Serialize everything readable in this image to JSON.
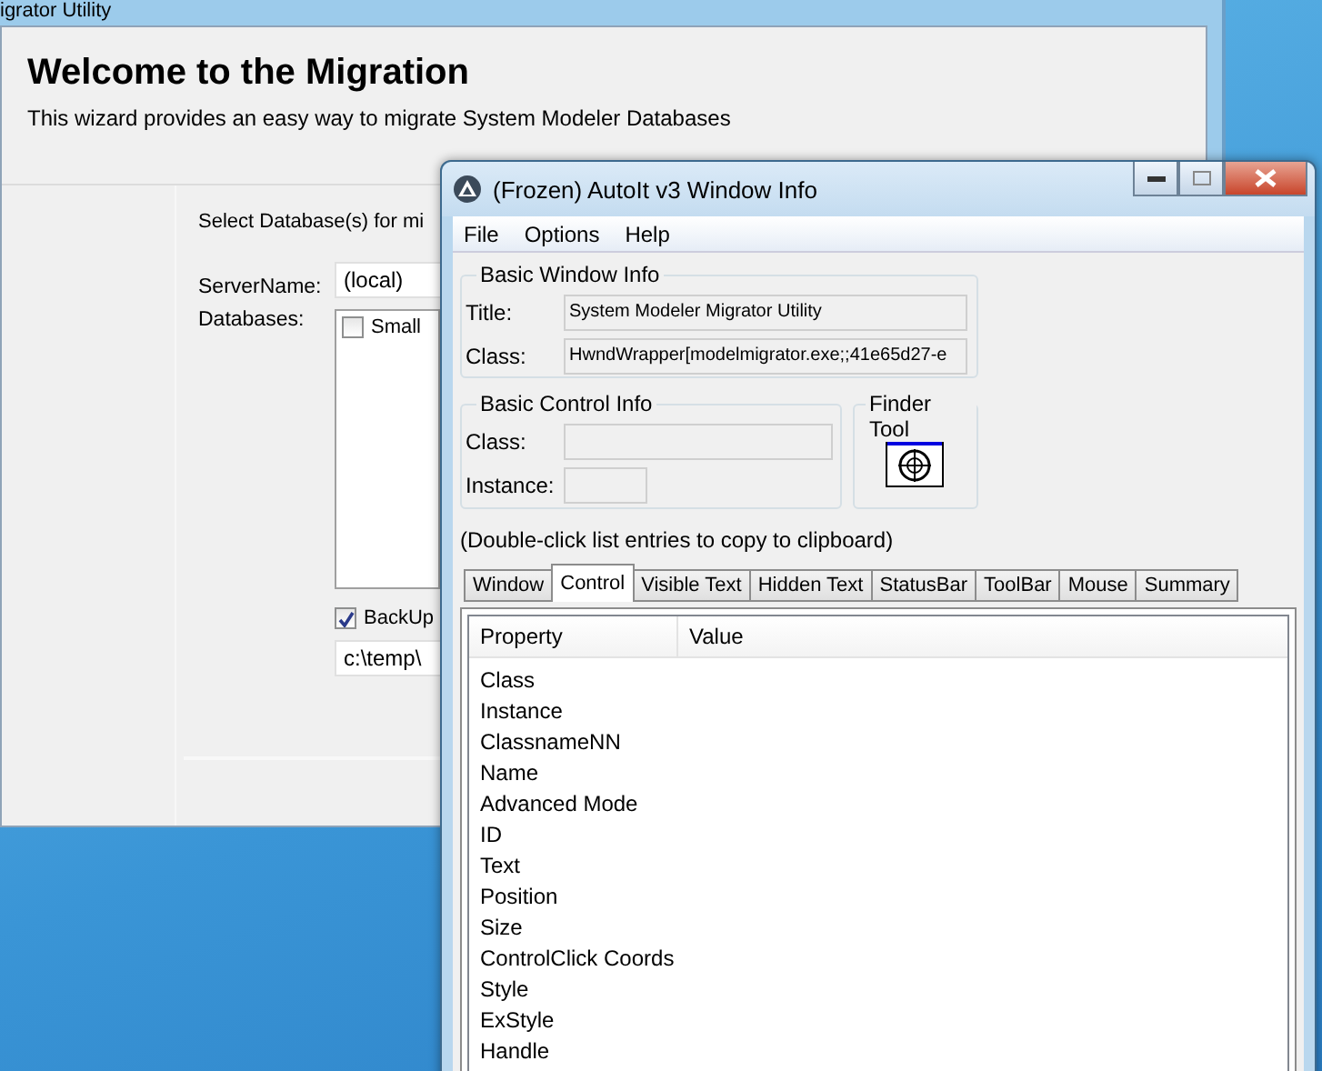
{
  "background_window": {
    "title": "igrator Utility",
    "heading": "Welcome to the Migration",
    "subtitle": "This wizard provides an easy way to migrate System Modeler Databases",
    "prompt": "Select Database(s) for mi",
    "server_label": "ServerName:",
    "server_value": "(local)",
    "databases_label": "Databases:",
    "databases": [
      {
        "label": "Small",
        "checked": false
      }
    ],
    "backup": {
      "label": "BackUp",
      "checked": true
    },
    "backup_path": "c:\\temp\\"
  },
  "autoit_window": {
    "title": "(Frozen) AutoIt v3 Window Info",
    "menu": [
      "File",
      "Options",
      "Help"
    ],
    "basic_window_info": {
      "legend": "Basic Window Info",
      "fields": [
        {
          "label": "Title:",
          "value": "System Modeler Migrator Utility"
        },
        {
          "label": "Class:",
          "value": "HwndWrapper[modelmigrator.exe;;41e65d27-e"
        }
      ]
    },
    "basic_control_info": {
      "legend": "Basic Control Info",
      "fields": [
        {
          "label": "Class:"
        },
        {
          "label": "Instance:"
        }
      ]
    },
    "finder_tool": {
      "legend": "Finder Tool"
    },
    "hint": "(Double-click list entries to copy to clipboard)",
    "tabs": [
      {
        "label": "Window",
        "selected": false
      },
      {
        "label": "Control",
        "selected": true
      },
      {
        "label": "Visible Text",
        "selected": false
      },
      {
        "label": "Hidden Text",
        "selected": false
      },
      {
        "label": "StatusBar",
        "selected": false
      },
      {
        "label": "ToolBar",
        "selected": false
      },
      {
        "label": "Mouse",
        "selected": false
      },
      {
        "label": "Summary",
        "selected": false
      }
    ],
    "list": {
      "columns": [
        "Property",
        "Value"
      ],
      "rows": [
        "Class",
        "Instance",
        "ClassnameNN",
        "Name",
        "Advanced Mode",
        "ID",
        "Text",
        "Position",
        "Size",
        "ControlClick Coords",
        "Style",
        "ExStyle",
        "Handle"
      ]
    }
  }
}
